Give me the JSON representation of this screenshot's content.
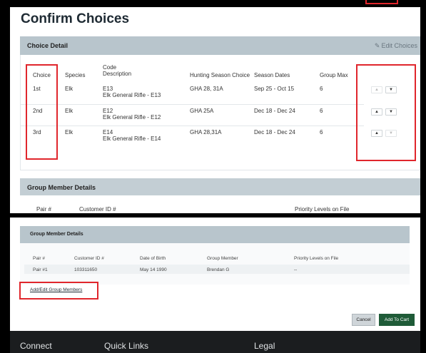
{
  "page": {
    "title": "Confirm Choices"
  },
  "choice_detail": {
    "header": "Choice Detail",
    "edit_label": "Edit Choices",
    "columns": {
      "choice": "Choice",
      "species": "Species",
      "code_line1": "Code",
      "code_line2": "Description",
      "hunting_season": "Hunting Season Choice",
      "season_dates": "Season Dates",
      "group_max": "Group Max"
    },
    "rows": [
      {
        "choice": "1st",
        "species": "Elk",
        "code": "E13",
        "description": "Elk General Rifle - E13",
        "hunting_season": "GHA 28, 31A",
        "season_dates": "Sep 25 - Oct 15",
        "group_max": "6",
        "up": "▲",
        "down": "▼"
      },
      {
        "choice": "2nd",
        "species": "Elk",
        "code": "E12",
        "description": "Elk General Rifle - E12",
        "hunting_season": "GHA 25A",
        "season_dates": "Dec 18 - Dec 24",
        "group_max": "6",
        "up": "▲",
        "down": "▼"
      },
      {
        "choice": "3rd",
        "species": "Elk",
        "code": "E14",
        "description": "Elk General Rifle - E14",
        "hunting_season": "GHA 28,31A",
        "season_dates": "Dec 18 - Dec 24",
        "group_max": "6",
        "up": "▲",
        "down": "▼"
      }
    ]
  },
  "group_member_partial": {
    "header": "Group Member Details",
    "columns": {
      "pair": "Pair #",
      "customer_id": "Customer ID #",
      "priority": "Priority Levels on File"
    }
  },
  "group_member": {
    "header": "Group Member Details",
    "columns": {
      "pair": "Pair #",
      "customer_id": "Customer ID #",
      "dob": "Date of Birth",
      "member": "Group Member",
      "priority": "Priority Levels on File"
    },
    "rows": [
      {
        "pair": "Pair #1",
        "customer_id": "103311650",
        "dob": "May 14 1990",
        "member": "Brendan G",
        "priority": "--"
      }
    ],
    "add_edit_link": "Add/Edit Group Members",
    "cancel_label": "Cancel",
    "add_to_cart_label": "Add To Cart"
  },
  "footer": {
    "connect": "Connect",
    "quick_links": "Quick Links",
    "legal": "Legal"
  },
  "colors": {
    "accent_green": "#1f5b38",
    "highlight_red": "#e0262c",
    "section_header": "#b8c5cc"
  }
}
